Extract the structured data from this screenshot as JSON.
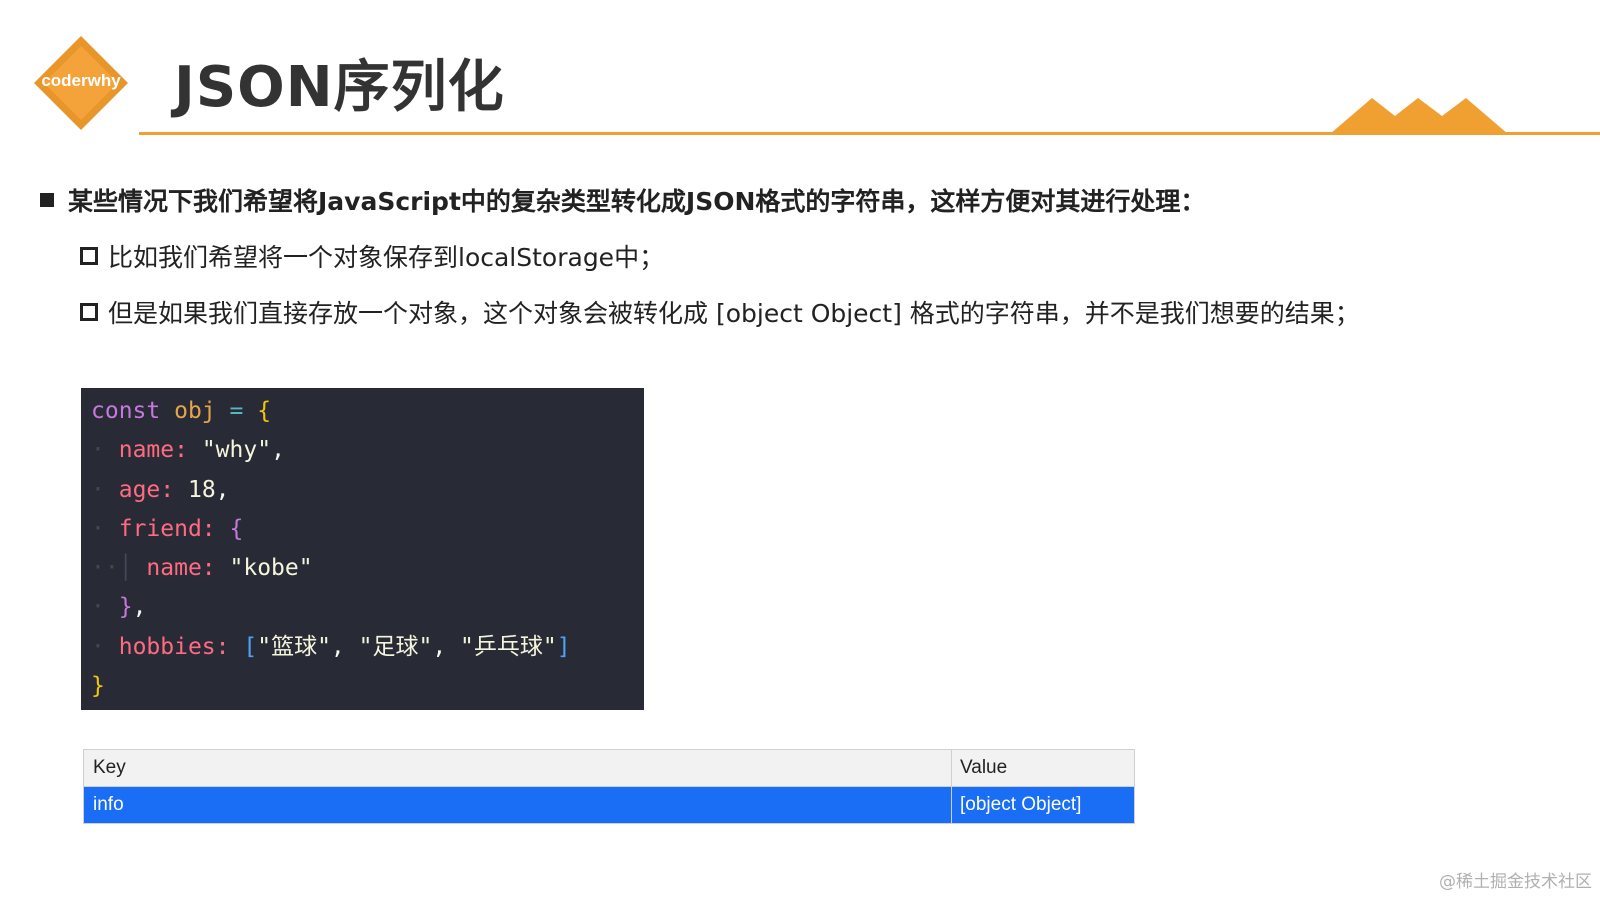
{
  "logo": {
    "text": "coderwhy",
    "color": "#f0a030"
  },
  "title": "JSON序列化",
  "bullets": {
    "main": "某些情况下我们希望将JavaScript中的复杂类型转化成JSON格式的字符串，这样方便对其进行处理：",
    "sub1": "比如我们希望将一个对象保存到localStorage中；",
    "sub2": "但是如果我们直接存放一个对象，这个对象会被转化成 [object Object] 格式的字符串，并不是我们想要的结果；"
  },
  "code": {
    "kw_const": "const",
    "var_obj": "obj",
    "eq": "=",
    "open": "{",
    "name_key": "name:",
    "name_val": "\"why\"",
    "age_key": "age:",
    "age_val": "18",
    "friend_key": "friend:",
    "friend_open": "{",
    "friend_name_key": "name:",
    "friend_name_val": "\"kobe\"",
    "friend_close": "}",
    "hobbies_key": "hobbies:",
    "hobbies_open": "[",
    "hobby1": "\"篮球\"",
    "hobby2": "\"足球\"",
    "hobby3": "\"乒乓球\"",
    "hobbies_close": "]",
    "close": "}"
  },
  "storage_table": {
    "headers": [
      "Key",
      "Value"
    ],
    "rows": [
      {
        "key": "info",
        "value": "[object Object]"
      }
    ]
  },
  "watermark": "@稀土掘金技术社区"
}
